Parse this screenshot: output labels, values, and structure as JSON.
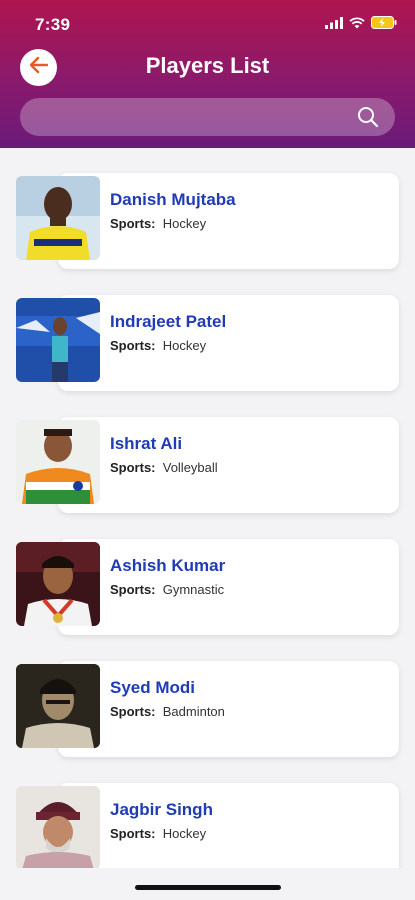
{
  "status_bar": {
    "time": "7:39"
  },
  "header": {
    "title": "Players List"
  },
  "search": {
    "placeholder": "",
    "value": ""
  },
  "colors": {
    "header_top": "#b0154e",
    "header_bottom": "#6a1a7a",
    "name_text": "#1f3cb4",
    "back_arrow": "#e65a2a"
  },
  "sports_label": "Sports:",
  "players": [
    {
      "name": "Danish Mujtaba",
      "sport": "Hockey"
    },
    {
      "name": "Indrajeet Patel",
      "sport": "Hockey"
    },
    {
      "name": "Ishrat Ali",
      "sport": "Volleyball"
    },
    {
      "name": "Ashish Kumar",
      "sport": "Gymnastic"
    },
    {
      "name": "Syed Modi",
      "sport": "Badminton"
    },
    {
      "name": "Jagbir Singh",
      "sport": "Hockey"
    }
  ]
}
